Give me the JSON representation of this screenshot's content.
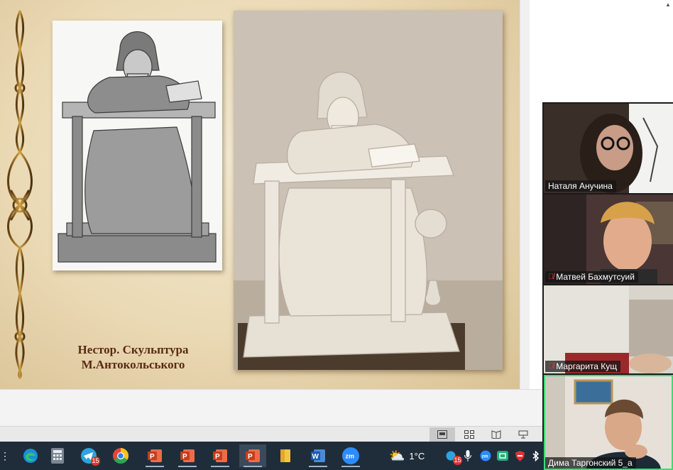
{
  "slide": {
    "caption_line1": "Нестор. Скульптура",
    "caption_line2": "М.Антокольського"
  },
  "colors": {
    "caption": "#5a2a12",
    "slide_bg": "#ead9b4",
    "active_speaker": "#3ddc74",
    "taskbar": "#1f2d3a"
  },
  "participants": [
    {
      "name": "Наталя Анучина",
      "muted": false
    },
    {
      "name": "Матвей Бахмутсуий",
      "muted": true
    },
    {
      "name": "Маргарита Кущ",
      "muted": true
    },
    {
      "name": "Дима Таргонский 5_а",
      "muted": false,
      "active": true
    }
  ],
  "taskbar": {
    "apps": [
      {
        "icon": "edge-icon"
      },
      {
        "icon": "calculator-icon"
      },
      {
        "icon": "telegram-icon",
        "badge": "15"
      },
      {
        "icon": "chrome-icon"
      },
      {
        "icon": "powerpoint-icon"
      },
      {
        "icon": "powerpoint-icon"
      },
      {
        "icon": "powerpoint-icon"
      },
      {
        "icon": "powerpoint-icon",
        "focused": true
      },
      {
        "icon": "file-explorer-icon"
      },
      {
        "icon": "word-icon"
      },
      {
        "icon": "zoom-icon",
        "label": "zm"
      }
    ],
    "weather": "1°C",
    "tray_badge": "15",
    "zoom_tray_label": "zm"
  },
  "status_bar": {
    "views": [
      "normal-view-icon",
      "slide-sorter-icon",
      "reading-view-icon",
      "slideshow-icon"
    ]
  }
}
